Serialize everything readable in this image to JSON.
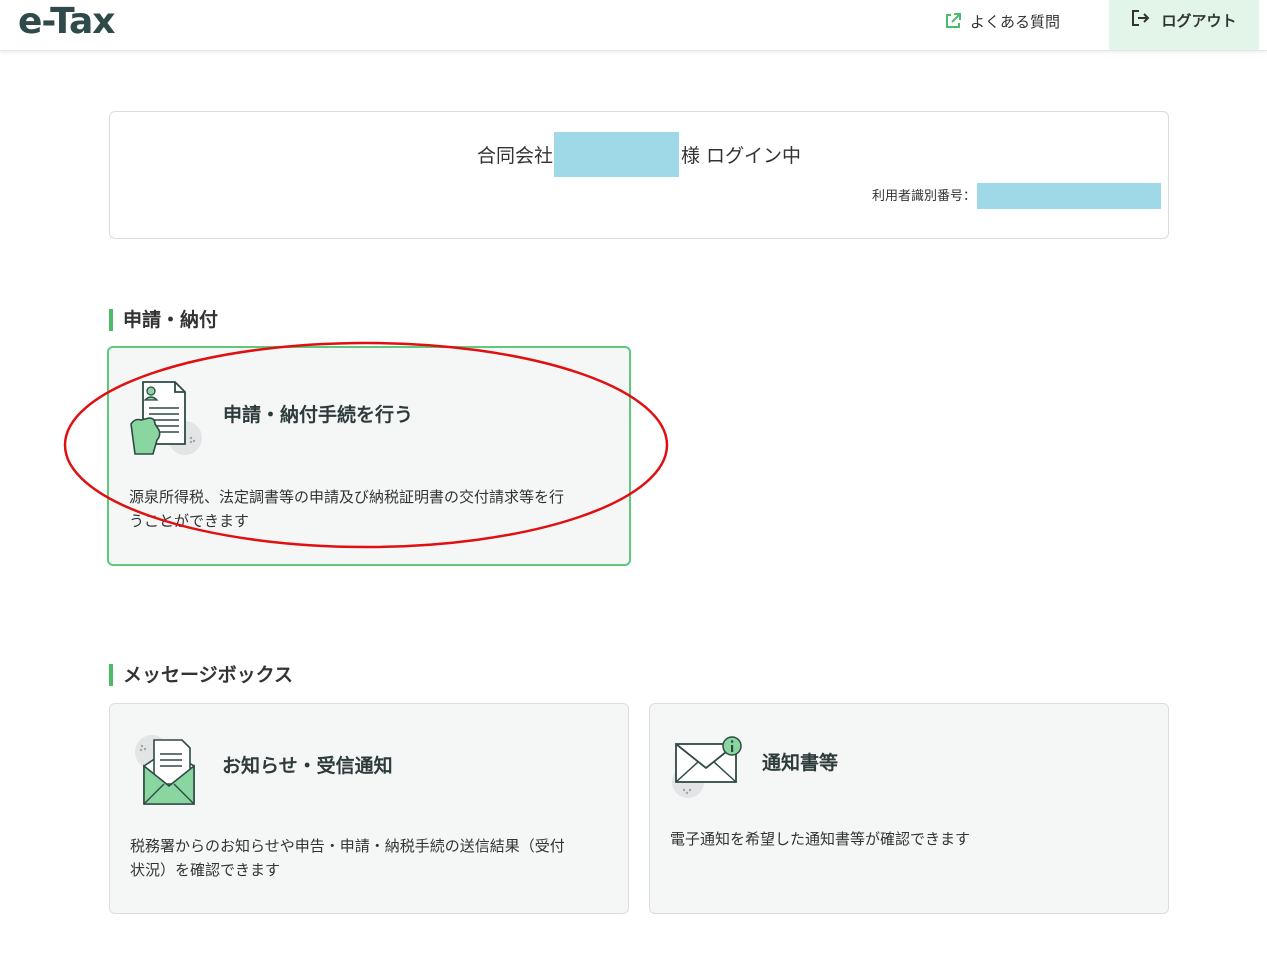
{
  "header": {
    "logo": "e-Tax",
    "faq_label": "よくある質問",
    "logout_label": "ログアウト"
  },
  "login": {
    "company_prefix": "合同会社",
    "suffix": "様 ログイン中",
    "user_id_label": "利用者識別番号："
  },
  "sections": {
    "apply": {
      "title": "申請・納付",
      "cards": [
        {
          "title": "申請・納付手続を行う",
          "description_line1": "源泉所得税、法定調書等の申請及び納税証明書の交付請求等を行",
          "description_line2": "うことができます"
        }
      ]
    },
    "messages": {
      "title": "メッセージボックス",
      "cards": [
        {
          "title": "お知らせ・受信通知",
          "description_line1": "税務署からのお知らせや申告・申請・納税手続の送信結果（受付",
          "description_line2": "状況）を確認できます"
        },
        {
          "title": "通知書等",
          "description_line1": "電子通知を希望した通知書等が確認できます"
        }
      ]
    }
  },
  "colors": {
    "accent_green": "#4cbb6c",
    "logout_bg": "#e3f5e8",
    "redaction": "#9fd9e8",
    "annotation_red": "#e01010"
  },
  "icons": {
    "faq": "external-link-icon",
    "logout": "logout-icon",
    "apply_card": "document-hand-icon",
    "notice_card": "envelope-letter-icon",
    "notification_card": "envelope-info-icon"
  }
}
